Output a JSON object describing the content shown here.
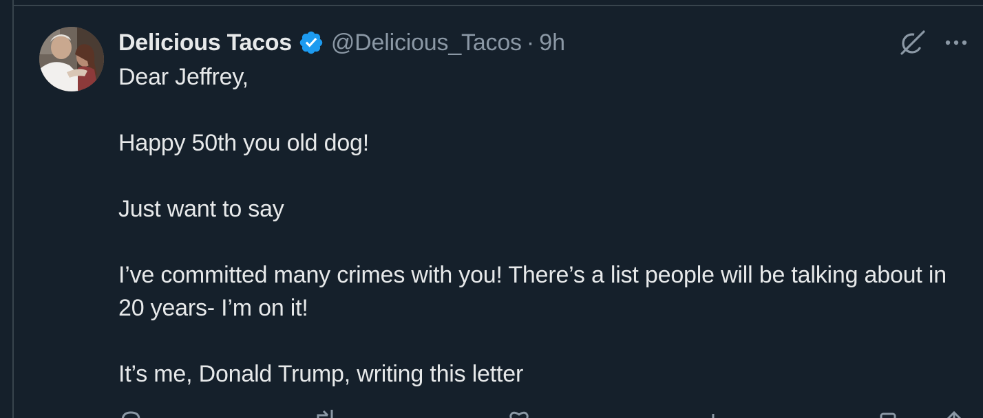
{
  "tweet": {
    "author": {
      "display_name": "Delicious Tacos",
      "handle": "@Delicious_Tacos",
      "verified": true,
      "verified_color": "#1d9bf0"
    },
    "separator": "·",
    "time": "9h",
    "paragraphs": [
      "Dear Jeffrey,",
      "Happy 50th you old dog!",
      "Just want to say",
      "I’ve committed many crimes with you! There’s a list people will be talking about in 20 years- I’m on it!",
      "It’s me, Donald Trump, writing this letter"
    ],
    "icons": {
      "grok": "grok-icon",
      "more": "more-icon",
      "reply": "reply-icon",
      "repost": "repost-icon",
      "like": "like-icon",
      "views": "views-icon",
      "bookmark": "bookmark-icon",
      "share": "share-icon"
    }
  },
  "theme": {
    "background": "#15202b",
    "text": "#e7e9ea",
    "secondary_text": "#8b98a5",
    "border": "#38444d"
  }
}
